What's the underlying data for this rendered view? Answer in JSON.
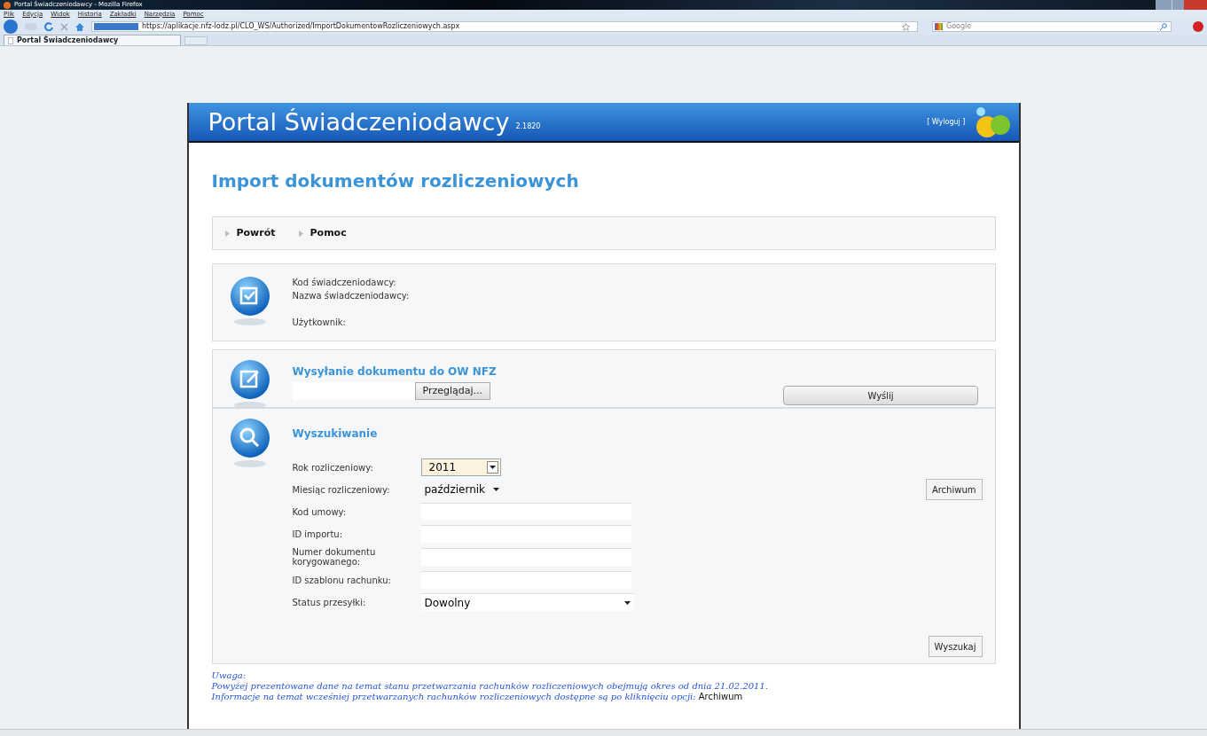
{
  "window": {
    "title": "Portal Świadczeniodawcy - Mozilla Firefox"
  },
  "menu": [
    "Plik",
    "Edycja",
    "Widok",
    "Historia",
    "Zakładki",
    "Narzędzia",
    "Pomoc"
  ],
  "address_bar": {
    "url": "https://aplikacje.nfz-lodz.pl/CLO_WS/Authorized/ImportDokumentowRozliczeniowych.aspx"
  },
  "search": {
    "placeholder": "Google"
  },
  "tabs": [
    {
      "label": "Portal Świadczeniodawcy",
      "selected": true
    }
  ],
  "portal": {
    "title": "Portal Świadczeniodawcy",
    "version": "2.1820",
    "logout": "[ Wyloguj ]"
  },
  "page_title": "Import dokumentów rozliczeniowych",
  "nav_links": [
    "Powrót",
    "Pomoc"
  ],
  "provider_info": [
    "Kod świadczeniodawcy:",
    "Nazwa świadczeniodawcy:",
    "Użytkownik:"
  ],
  "upload": {
    "heading": "Wysyłanie dokumentu do OW NFZ",
    "browse_button": "Przeglądaj...",
    "send_button": "Wyślij"
  },
  "search_form": {
    "heading": "Wyszukiwanie",
    "archive_button": "Archiwum",
    "search_button": "Wyszukaj",
    "fields": [
      {
        "label": "Rok rozliczeniowy:",
        "kind": "combo",
        "value": "2011"
      },
      {
        "label": "Miesiąc rozliczeniowy:",
        "kind": "select",
        "value": "październik"
      },
      {
        "label": "Kod umowy:",
        "kind": "text"
      },
      {
        "label": "ID importu:",
        "kind": "text"
      },
      {
        "label": "Numer dokumentu korygowanego:",
        "kind": "text"
      },
      {
        "label": "ID szablonu rachunku:",
        "kind": "text"
      },
      {
        "label": "Status przesyłki:",
        "kind": "wideselect",
        "value": "Dowolny"
      }
    ]
  },
  "notes": {
    "heading": "Uwaga:",
    "lines": [
      "Powyżej prezentowane dane na temat stanu przetwarzania rachunków rozliczeniowych obejmują okres od dnia 21.02.2011.",
      "Informacje na temat wcześniej przetwarzanych rachunków rozliczeniowych dostępne są po kliknięciu opcji:"
    ],
    "link": "Archiwum"
  }
}
